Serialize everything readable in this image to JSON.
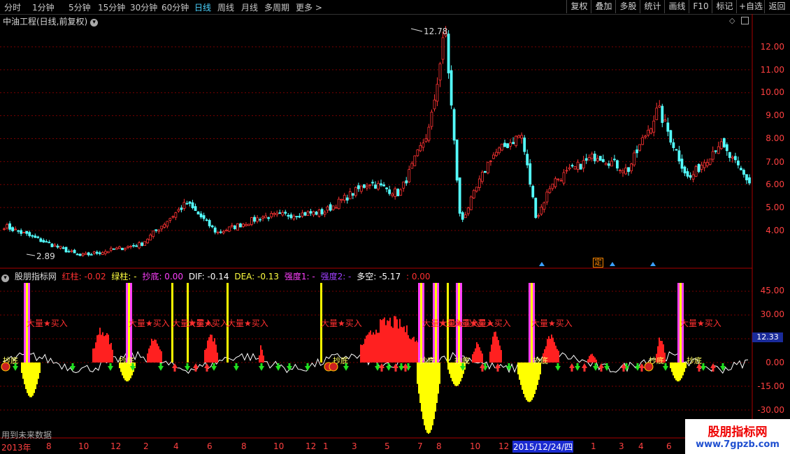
{
  "toolbar": {
    "periods": [
      "分时",
      "1分钟",
      "5分钟",
      "15分钟",
      "30分钟",
      "60分钟",
      "日线",
      "周线",
      "月线",
      "多周期",
      "更多"
    ],
    "more_arrow": ">",
    "active_period": "日线",
    "right_buttons": [
      "复权",
      "叠加",
      "多股",
      "统计",
      "画线",
      "F10",
      "标记",
      "+自选",
      "返回"
    ]
  },
  "chart": {
    "title": "中油工程(日线,前复权)",
    "high_label": "12.78",
    "low_label": "2.89",
    "y_axis": [
      "12.00",
      "11.00",
      "10.00",
      "9.00",
      "8.00",
      "7.00",
      "6.00",
      "5.00",
      "4.00"
    ],
    "ylim": [
      2.5,
      13.5
    ],
    "ding_label": "定"
  },
  "indicator": {
    "name": "股朋指标网",
    "items": [
      {
        "label": "红柱: -0.02",
        "color": "#ff3030"
      },
      {
        "label": "绿柱: -",
        "color": "#ffff40"
      },
      {
        "label": "抄底: 0.00",
        "color": "#ff40ff"
      },
      {
        "label": "DIF: -0.14",
        "color": "#ffffff"
      },
      {
        "label": "DEA: -0.13",
        "color": "#ffff40"
      },
      {
        "label": "强度1: -",
        "color": "#ff40ff"
      },
      {
        "label": "强度2: -",
        "color": "#a040ff"
      },
      {
        "label": "多空: -5.17",
        "color": "#ffffff"
      },
      {
        "label": ": 0.00",
        "color": "#ff3030"
      }
    ],
    "y_axis": [
      "45.00",
      "30.00",
      "15.00",
      "0.00",
      "-15.00",
      "-30.00"
    ],
    "current_value": "12.33",
    "signal_text": "大量★买入",
    "bottom_text": "抄底",
    "future_note": "用到未来数据"
  },
  "x_axis": {
    "labels": [
      "2013年",
      "8",
      "10",
      "12",
      "2",
      "4",
      "6",
      "8",
      "10",
      "12",
      "1",
      "3",
      "5",
      "7",
      "8",
      "10",
      "12",
      "2015/12/24/四",
      "1",
      "3",
      "4",
      "6"
    ]
  },
  "watermark": {
    "line1": "股朋指标网",
    "line2": "www.7gpzb.com"
  },
  "colors": {
    "up": "#ff3333",
    "down": "#54ffff",
    "grid": "#7a0000",
    "axis": "#ff4040",
    "volume_signal": "#ffff00"
  },
  "chart_data": {
    "type": "candlestick",
    "title": "中油工程(日线,前复权)",
    "key_points": [
      {
        "t": "2013-01",
        "close": 4.2
      },
      {
        "t": "2013-06",
        "close": 2.89
      },
      {
        "t": "2013-10",
        "close": 3.4
      },
      {
        "t": "2014-01",
        "close": 5.2
      },
      {
        "t": "2014-03",
        "close": 3.9
      },
      {
        "t": "2014-06",
        "close": 4.6
      },
      {
        "t": "2014-10",
        "close": 4.8
      },
      {
        "t": "2015-01",
        "close": 6.1
      },
      {
        "t": "2015-03",
        "close": 5.6
      },
      {
        "t": "2015-05",
        "close": 8.5
      },
      {
        "t": "2015-06",
        "close": 12.78
      },
      {
        "t": "2015-07",
        "close": 4.3
      },
      {
        "t": "2015-09",
        "close": 7.2
      },
      {
        "t": "2015-11",
        "close": 8.2
      },
      {
        "t": "2015-12",
        "close": 4.5
      },
      {
        "t": "2016-01",
        "close": 6.1
      },
      {
        "t": "2016-04",
        "close": 7.3
      },
      {
        "t": "2016-06",
        "close": 6.6
      },
      {
        "t": "2016-08",
        "close": 9.3
      },
      {
        "t": "2016-10",
        "close": 6.2
      },
      {
        "t": "2016-12",
        "close": 7.8
      },
      {
        "t": "2017-02",
        "close": 6.1
      }
    ],
    "ylim": [
      2.5,
      13.5
    ]
  }
}
